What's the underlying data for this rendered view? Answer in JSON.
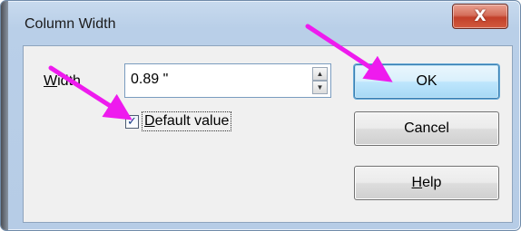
{
  "window": {
    "title": "Column Width",
    "close_glyph": "X"
  },
  "form": {
    "width_label_first": "W",
    "width_label_rest": "idth",
    "width_value": "0.89 \"",
    "default_checkbox_checked": true,
    "default_label_first": "D",
    "default_label_rest": "efault value"
  },
  "buttons": {
    "ok_label": "OK",
    "cancel_label": "Cancel",
    "help_label_first": "H",
    "help_label_rest": "elp"
  },
  "annotations": {
    "arrow_color": "#ee1bee"
  },
  "icons": [
    "close-icon",
    "spin-up-icon",
    "spin-down-icon",
    "checkmark-icon",
    "arrow-annotation"
  ]
}
